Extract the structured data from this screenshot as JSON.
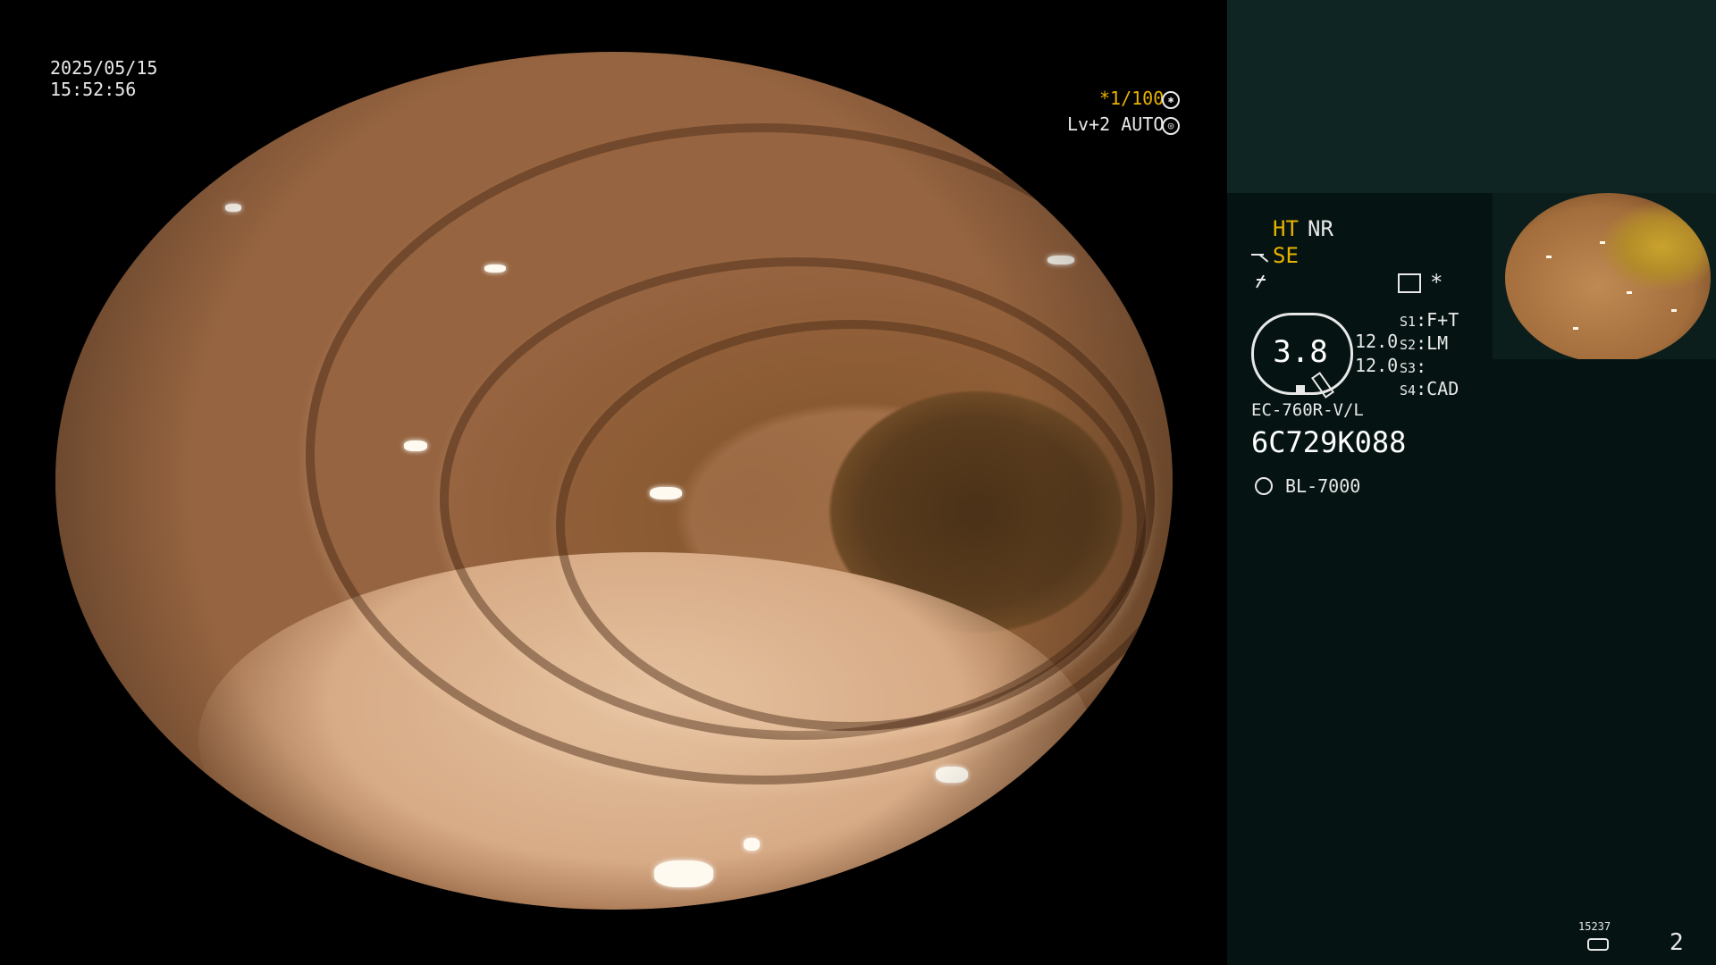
{
  "overlay": {
    "date": "2025/05/15",
    "time": "15:52:56",
    "shutter": "*1/100",
    "shutter_icon": "aperture-icon",
    "level": "Lv+2 AUTO",
    "auto_icon": "iris-icon"
  },
  "panel": {
    "ht": "HT",
    "nr": "NR",
    "se": "SE",
    "gauge_value": "3.8",
    "gain_1": "12.0",
    "gain_2": "12.0",
    "switches": [
      {
        "key": "S1",
        "value": "F+T"
      },
      {
        "key": "S2",
        "value": "LM"
      },
      {
        "key": "S3",
        "value": ""
      },
      {
        "key": "S4",
        "value": "CAD"
      }
    ],
    "scope_model": "EC-760R-V/L",
    "scope_serial": "6C729K088",
    "light_source": "BL-7000",
    "asterisk": "*",
    "counter_small": "15237",
    "page_number": "2"
  },
  "colors": {
    "panel_bg": "#051412",
    "panel_top_bg": "#0e2524",
    "accent_yellow": "#e8b200",
    "osd_text": "#e8e8e8"
  }
}
